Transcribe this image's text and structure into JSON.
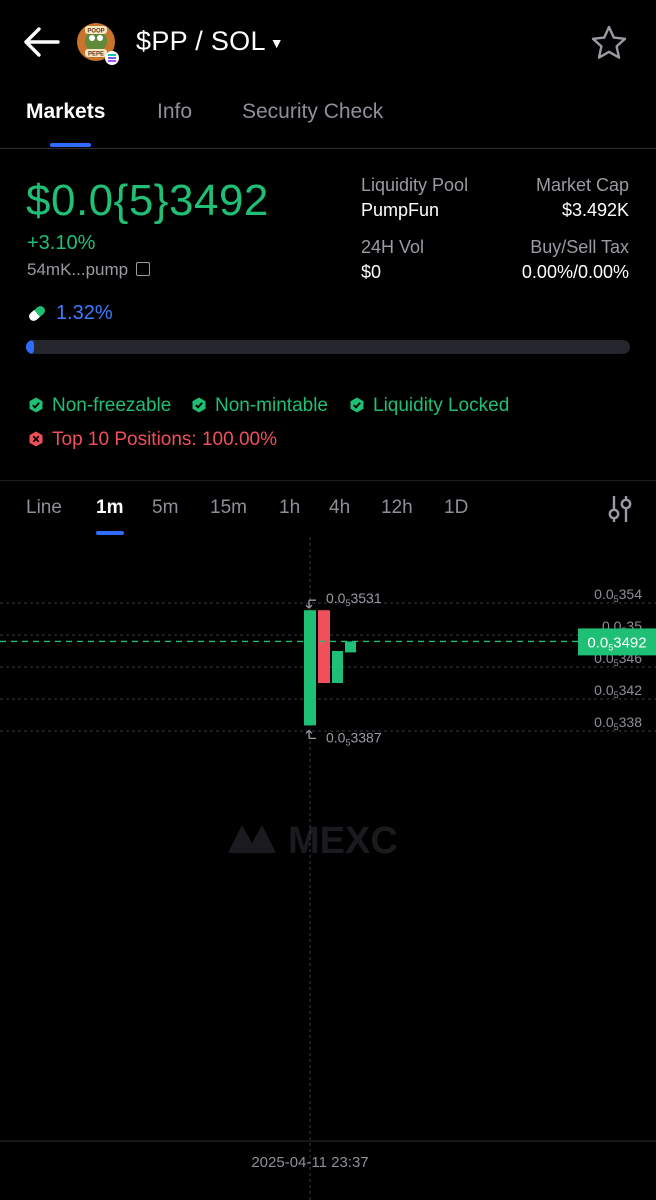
{
  "header": {
    "pair": "$PP / SOL",
    "logo_text_top": "POOP",
    "logo_text_bottom": "PEPE"
  },
  "tabs": [
    "Markets",
    "Info",
    "Security Check"
  ],
  "token": {
    "price": "$0.0{5}3492",
    "change": "+3.10%",
    "address": "54mK...pump",
    "progress_pct": "1.32%",
    "progress_value": 0.0132
  },
  "stats": {
    "liquidity_pool_label": "Liquidity Pool",
    "liquidity_pool_value": "PumpFun",
    "market_cap_label": "Market Cap",
    "market_cap_value": "$3.492K",
    "vol_label": "24H Vol",
    "vol_value": "$0",
    "tax_label": "Buy/Sell Tax",
    "tax_value": "0.00%/0.00%"
  },
  "badges": {
    "non_freezable": "Non-freezable",
    "non_mintable": "Non-mintable",
    "liquidity_locked": "Liquidity Locked",
    "top10": "Top 10 Positions: 100.00%"
  },
  "timeframes": [
    "Line",
    "1m",
    "5m",
    "15m",
    "1h",
    "4h",
    "12h",
    "1D"
  ],
  "colors": {
    "up": "#1fbf75",
    "down": "#f0505a",
    "accent": "#2f6bff"
  },
  "chart_data": {
    "type": "candlestick",
    "y_ticks": [
      {
        "base": "0.0",
        "sub": "5",
        "rest": "354",
        "value": 3.54e-05
      },
      {
        "base": "0.0",
        "sub": "5",
        "rest": "35",
        "value": 3.5e-05
      },
      {
        "base": "0.0",
        "sub": "5",
        "rest": "346",
        "value": 3.46e-05
      },
      {
        "base": "0.0",
        "sub": "5",
        "rest": "342",
        "value": 3.42e-05
      },
      {
        "base": "0.0",
        "sub": "5",
        "rest": "338",
        "value": 3.38e-05
      }
    ],
    "current_price": {
      "base": "0.0",
      "sub": "5",
      "rest": "3492",
      "value": 3.492e-05
    },
    "high_label": {
      "base": "0.0",
      "sub": "5",
      "rest": "3531"
    },
    "low_label": {
      "base": "0.0",
      "sub": "5",
      "rest": "3387"
    },
    "x_label": "2025-04-11 23:37",
    "watermark": "MEXC",
    "candles": [
      {
        "open": 3.387e-05,
        "close": 3.531e-05,
        "high": 3.531e-05,
        "low": 3.387e-05,
        "dir": "up"
      },
      {
        "open": 3.531e-05,
        "close": 3.44e-05,
        "high": 3.531e-05,
        "low": 3.44e-05,
        "dir": "down"
      },
      {
        "open": 3.44e-05,
        "close": 3.48e-05,
        "high": 3.48e-05,
        "low": 3.44e-05,
        "dir": "up"
      },
      {
        "open": 3.49e-05,
        "close": 3.492e-05,
        "high": 3.492e-05,
        "low": 3.49e-05,
        "dir": "up"
      }
    ]
  }
}
